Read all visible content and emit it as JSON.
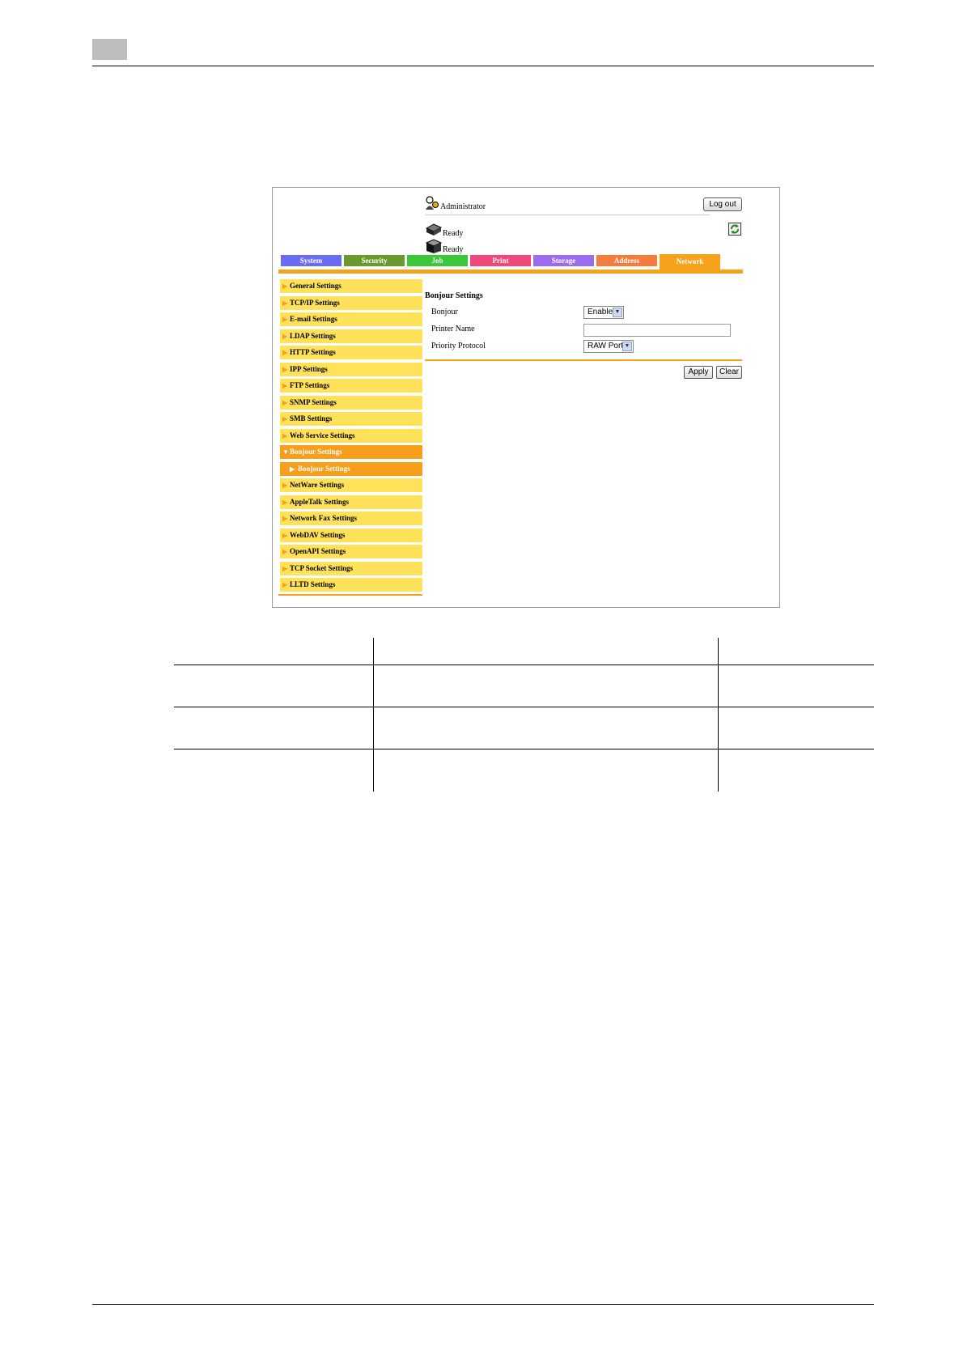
{
  "header": {
    "user_label": "Administrator",
    "logout_label": "Log out",
    "status": [
      "Ready",
      "Ready"
    ]
  },
  "tabs": [
    {
      "label": "System",
      "color": "#6b6bf2"
    },
    {
      "label": "Security",
      "color": "#6a9a2e"
    },
    {
      "label": "Job",
      "color": "#3ac83a"
    },
    {
      "label": "Print",
      "color": "#f0487a"
    },
    {
      "label": "Storage",
      "color": "#9d6bf0"
    },
    {
      "label": "Address",
      "color": "#f57c3c"
    },
    {
      "label": "Network",
      "color": "#f7a21b",
      "active": true
    }
  ],
  "sidebar": {
    "items": [
      "General Settings",
      "TCP/IP Settings",
      "E-mail Settings",
      "LDAP Settings",
      "HTTP Settings",
      "IPP Settings",
      "FTP Settings",
      "SNMP Settings",
      "SMB Settings",
      "Web Service Settings",
      "Bonjour Settings",
      "Bonjour Settings",
      "NetWare Settings",
      "AppleTalk Settings",
      "Network Fax Settings",
      "WebDAV Settings",
      "OpenAPI Settings",
      "TCP Socket Settings",
      "LLTD Settings"
    ]
  },
  "content": {
    "title": "Bonjour Settings",
    "bonjour_label": "Bonjour",
    "bonjour_value": "Enable",
    "printer_name_label": "Printer Name",
    "printer_name_value": "",
    "priority_label": "Priority Protocol",
    "priority_value": "RAW Port",
    "apply_label": "Apply",
    "clear_label": "Clear"
  },
  "colors": {
    "accent_orange": "#f5a21c",
    "sidebar_yellow": "#ffe15a"
  }
}
